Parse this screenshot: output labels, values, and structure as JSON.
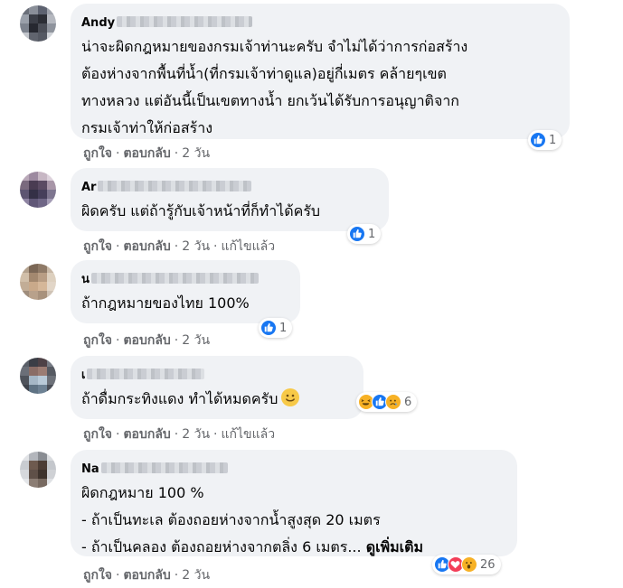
{
  "comments": [
    {
      "author": "Andy",
      "lines": [
        "น่าจะผิดกฎหมายของกรมเจ้าท่านะครับ จำไม่ได้ว่าการก่อสร้าง",
        "ต้องห่างจากพื้นที่น้ำ(ที่กรมเจ้าท่าดูแล)อยู่กี่เมตร คล้ายๆเขต",
        "ทางหลวง แต่อันนี้เป็นเขตทางน้ำ ยกเว้นได้รับการอนุญาติจาก",
        "กรมเจ้าท่าให้ก่อสร้าง"
      ],
      "like_label": "ถูกใจ",
      "reply_label": "ตอบกลับ",
      "time": "2 วัน",
      "edited": "",
      "reactions": [
        "like-icon"
      ],
      "reaction_count": "1"
    },
    {
      "author": "Ar",
      "lines": [
        "ผิดครับ แต่ถ้ารู้กับเจ้าหน้าที่ก็ทำได้ครับ"
      ],
      "like_label": "ถูกใจ",
      "reply_label": "ตอบกลับ",
      "time": "2 วัน",
      "edited": "แก้ไขแล้ว",
      "reactions": [
        "like-icon"
      ],
      "reaction_count": "1"
    },
    {
      "author": "น",
      "lines": [
        "ถ้ากฎหมายของไทย 100%"
      ],
      "like_label": "ถูกใจ",
      "reply_label": "ตอบกลับ",
      "time": "2 วัน",
      "edited": "",
      "reactions": [
        "like-icon"
      ],
      "reaction_count": "1"
    },
    {
      "author": "เ",
      "lines": [
        "ถ้าดื่มกระทิงแดง ทำได้หมดครับ"
      ],
      "like_label": "ถูกใจ",
      "reply_label": "ตอบกลับ",
      "time": "2 วัน",
      "edited": "แก้ไขแล้ว",
      "reactions": [
        "haha-icon",
        "like-icon",
        "sad-icon"
      ],
      "reaction_count": "6"
    },
    {
      "author": "Na",
      "lines": [
        "ผิดกฎหมาย 100 %",
        "- ถ้าเป็นทะเล ต้องถอยห่างจากน้ำสูงสุด 20 เมตร",
        "- ถ้าเป็นคลอง ต้องถอยห่างจากตลิ่ง 6 เมตร..."
      ],
      "see_more": "ดูเพิ่มเติม",
      "like_label": "ถูกใจ",
      "reply_label": "ตอบกลับ",
      "time": "2 วัน",
      "edited": "",
      "reactions": [
        "like-icon",
        "heart-icon",
        "wow-icon"
      ],
      "reaction_count": "26"
    }
  ],
  "colors": {
    "bubble_bg": "#f0f2f5",
    "meta_text": "#65676b",
    "like_blue": "#1877f2",
    "love_red": "#f33e58",
    "emoji_yellow": "#f7b125"
  }
}
